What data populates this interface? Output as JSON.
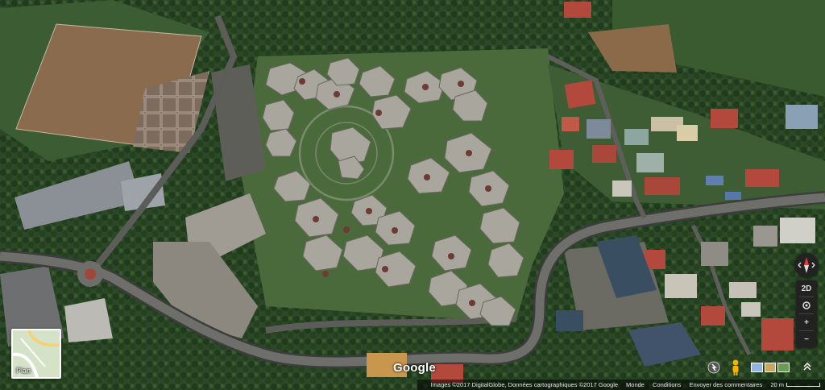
{
  "map": {
    "type": "satellite",
    "logo": "Google",
    "map_type_toggle": {
      "label": "Plan",
      "icon": "map-thumbnail-icon"
    },
    "attribution": {
      "imagery": "Images ©2017 DigitalGlobe, Données cartographiques ©2017 Google",
      "region": "Monde",
      "terms": "Conditions",
      "feedback": "Envoyer des commentaires",
      "scale_label": "20 m"
    },
    "controls": {
      "compass_icon": "compass-icon",
      "tilt_label": "2D",
      "location_icon": "my-location-icon",
      "zoom_in_label": "+",
      "zoom_out_label": "−"
    },
    "colors": {
      "vegetation": "#2f4a2a",
      "road": "#4a4a4a",
      "roof_red": "#b3493d",
      "building_grey": "#9a9791"
    }
  }
}
